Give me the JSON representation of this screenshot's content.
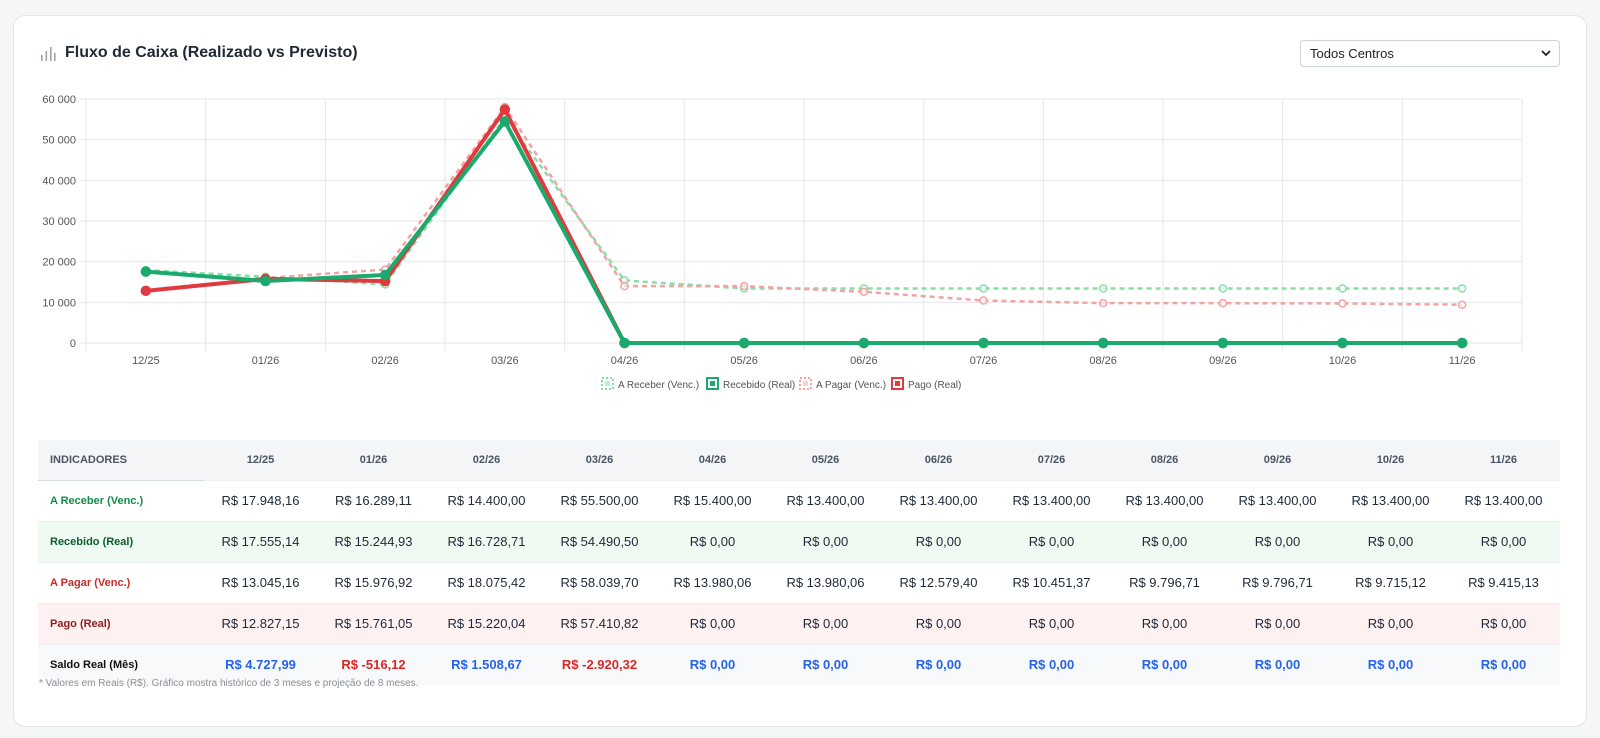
{
  "header": {
    "title": "Fluxo de Caixa (Realizado vs Previsto)",
    "filter_value": "Todos Centros"
  },
  "chart_data": {
    "type": "line",
    "categories": [
      "12/25",
      "01/26",
      "02/26",
      "03/26",
      "04/26",
      "05/26",
      "06/26",
      "07/26",
      "08/26",
      "09/26",
      "10/26",
      "11/26"
    ],
    "ylim": [
      0,
      60000
    ],
    "yticks": [
      "0",
      "10 000",
      "20 000",
      "30 000",
      "40 000",
      "50 000",
      "60 000"
    ],
    "grid": true,
    "legend_position": "bottom",
    "series": [
      {
        "name": "A Receber (Venc.)",
        "style": "dashed",
        "color": "#86e0a4",
        "values": [
          17948.16,
          16289.11,
          14400.0,
          55500.0,
          15400.0,
          13400.0,
          13400.0,
          13400.0,
          13400.0,
          13400.0,
          13400.0,
          13400.0
        ]
      },
      {
        "name": "Recebido (Real)",
        "style": "solid",
        "color": "#1aaa6e",
        "values": [
          17555.14,
          15244.93,
          16728.71,
          54490.5,
          0,
          0,
          0,
          0,
          0,
          0,
          0,
          0
        ]
      },
      {
        "name": "A Pagar (Venc.)",
        "style": "dashed",
        "color": "#f3a3a3",
        "values": [
          13045.16,
          15976.92,
          18075.42,
          58039.7,
          13980.06,
          13980.06,
          12579.4,
          10451.37,
          9796.71,
          9796.71,
          9715.12,
          9415.13
        ]
      },
      {
        "name": "Pago (Real)",
        "style": "solid",
        "color": "#e0393e",
        "values": [
          12827.15,
          15761.05,
          15220.04,
          57410.82,
          0,
          0,
          0,
          0,
          0,
          0,
          0,
          0
        ]
      }
    ]
  },
  "table": {
    "header_label": "INDICADORES",
    "months": [
      "12/25",
      "01/26",
      "02/26",
      "03/26",
      "04/26",
      "05/26",
      "06/26",
      "07/26",
      "08/26",
      "09/26",
      "10/26",
      "11/26"
    ],
    "rows": [
      {
        "key": "r-areceber",
        "label": "A Receber (Venc.)",
        "values": [
          "R$ 17.948,16",
          "R$ 16.289,11",
          "R$ 14.400,00",
          "R$ 55.500,00",
          "R$ 15.400,00",
          "R$ 13.400,00",
          "R$ 13.400,00",
          "R$ 13.400,00",
          "R$ 13.400,00",
          "R$ 13.400,00",
          "R$ 13.400,00",
          "R$ 13.400,00"
        ]
      },
      {
        "key": "r-recebido",
        "label": "Recebido (Real)",
        "values": [
          "R$ 17.555,14",
          "R$ 15.244,93",
          "R$ 16.728,71",
          "R$ 54.490,50",
          "R$ 0,00",
          "R$ 0,00",
          "R$ 0,00",
          "R$ 0,00",
          "R$ 0,00",
          "R$ 0,00",
          "R$ 0,00",
          "R$ 0,00"
        ]
      },
      {
        "key": "r-apagar",
        "label": "A Pagar (Venc.)",
        "values": [
          "R$ 13.045,16",
          "R$ 15.976,92",
          "R$ 18.075,42",
          "R$ 58.039,70",
          "R$ 13.980,06",
          "R$ 13.980,06",
          "R$ 12.579,40",
          "R$ 10.451,37",
          "R$ 9.796,71",
          "R$ 9.796,71",
          "R$ 9.715,12",
          "R$ 9.415,13"
        ]
      },
      {
        "key": "r-pago",
        "label": "Pago (Real)",
        "values": [
          "R$ 12.827,15",
          "R$ 15.761,05",
          "R$ 15.220,04",
          "R$ 57.410,82",
          "R$ 0,00",
          "R$ 0,00",
          "R$ 0,00",
          "R$ 0,00",
          "R$ 0,00",
          "R$ 0,00",
          "R$ 0,00",
          "R$ 0,00"
        ]
      },
      {
        "key": "r-saldo",
        "label": "Saldo Real (Mês)",
        "values": [
          "R$ 4.727,99",
          "R$ -516,12",
          "R$ 1.508,67",
          "R$ -2.920,32",
          "R$ 0,00",
          "R$ 0,00",
          "R$ 0,00",
          "R$ 0,00",
          "R$ 0,00",
          "R$ 0,00",
          "R$ 0,00",
          "R$ 0,00"
        ]
      }
    ]
  },
  "footnote": "* Valores em Reais (R$). Gráfico mostra histórico de 3 meses e projeção de 8 meses."
}
